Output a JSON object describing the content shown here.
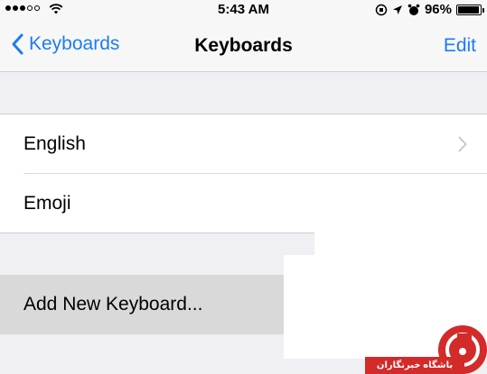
{
  "status_bar": {
    "time": "5:43 AM",
    "battery_percent": "96%",
    "battery_level": 0.96,
    "signal_bars_filled": 3,
    "signal_bars_total": 5
  },
  "nav": {
    "back_label": "Keyboards",
    "title": "Keyboards",
    "edit_label": "Edit"
  },
  "keyboards": {
    "items": [
      {
        "label": "English"
      },
      {
        "label": "Emoji"
      }
    ]
  },
  "add_keyboard": {
    "label": "Add New Keyboard..."
  },
  "watermark": {
    "text": "باشگاه خبرنگاران"
  },
  "colors": {
    "accent": "#1b7cf5",
    "background": "#efeff4",
    "highlight_row": "#d9d9d9"
  }
}
